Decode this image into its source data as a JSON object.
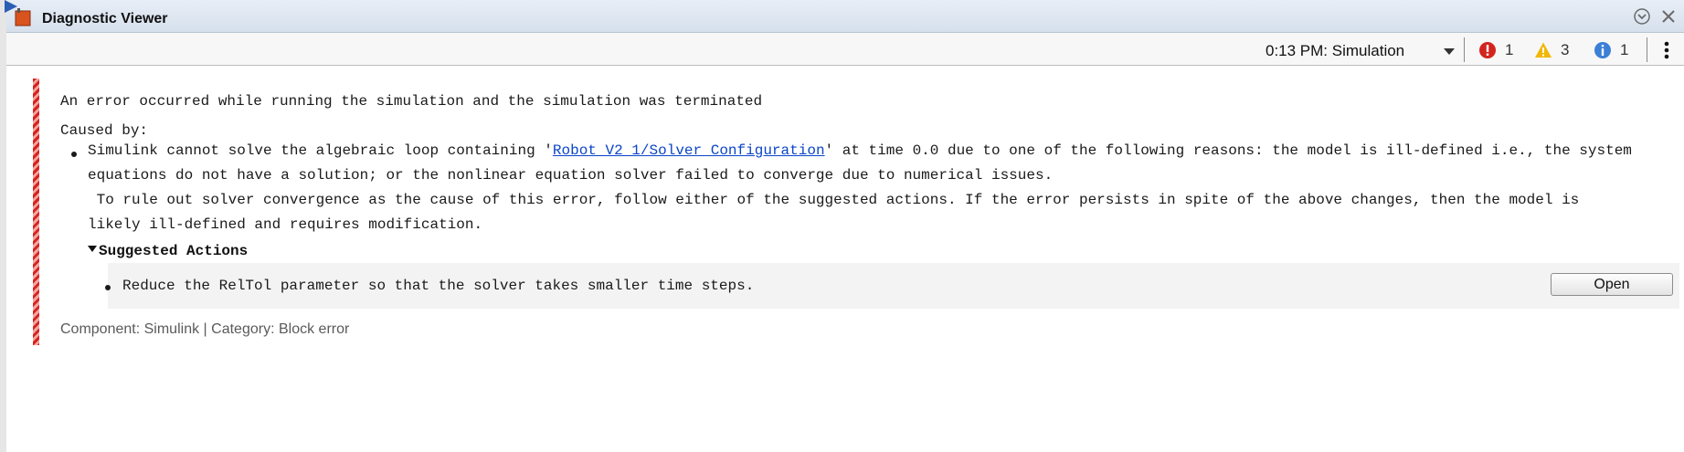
{
  "window": {
    "title": "Diagnostic Viewer"
  },
  "toolbar": {
    "run_selector": "0:13 PM: Simulation",
    "error_count": "1",
    "warning_count": "3",
    "info_count": "1"
  },
  "message": {
    "headline": "An error occurred while running the simulation and the simulation was terminated",
    "caused_by_label": "Caused by:",
    "cause": {
      "line1_pre": "Simulink cannot solve the algebraic loop containing '",
      "link_text": "Robot_V2_1/Solver Configuration",
      "line1_post": "' at time 0.0 due to one of the following reasons: the model is ill-defined i.e., the system",
      "line2": "equations do not have a solution; or the nonlinear equation solver failed to converge due to numerical issues.",
      "line3": " To rule out solver convergence as the cause of this error, follow either of the suggested actions. If the error persists in spite of the above changes, then the model is",
      "line4": "likely ill-defined and requires modification."
    },
    "suggested_actions": {
      "header": "Suggested Actions",
      "items": [
        {
          "text": "Reduce the RelTol parameter so that the solver takes smaller time steps.",
          "button_label": "Open"
        }
      ]
    },
    "component_label": "Component:",
    "component_value": "Simulink",
    "separator": "|",
    "category_label": "Category:",
    "category_value": "Block error"
  },
  "colors": {
    "error_red": "#d3241f",
    "warning_yellow": "#f2b705",
    "info_blue": "#3b7fd6",
    "link_blue": "#0b45c8"
  },
  "icons": {
    "app": "simulink-app-icon",
    "minimize_menu": "chevron-circle-down-icon",
    "close": "close-icon",
    "error": "error-icon",
    "warning": "warning-icon",
    "info": "info-icon",
    "more": "kebab-menu-icon"
  }
}
